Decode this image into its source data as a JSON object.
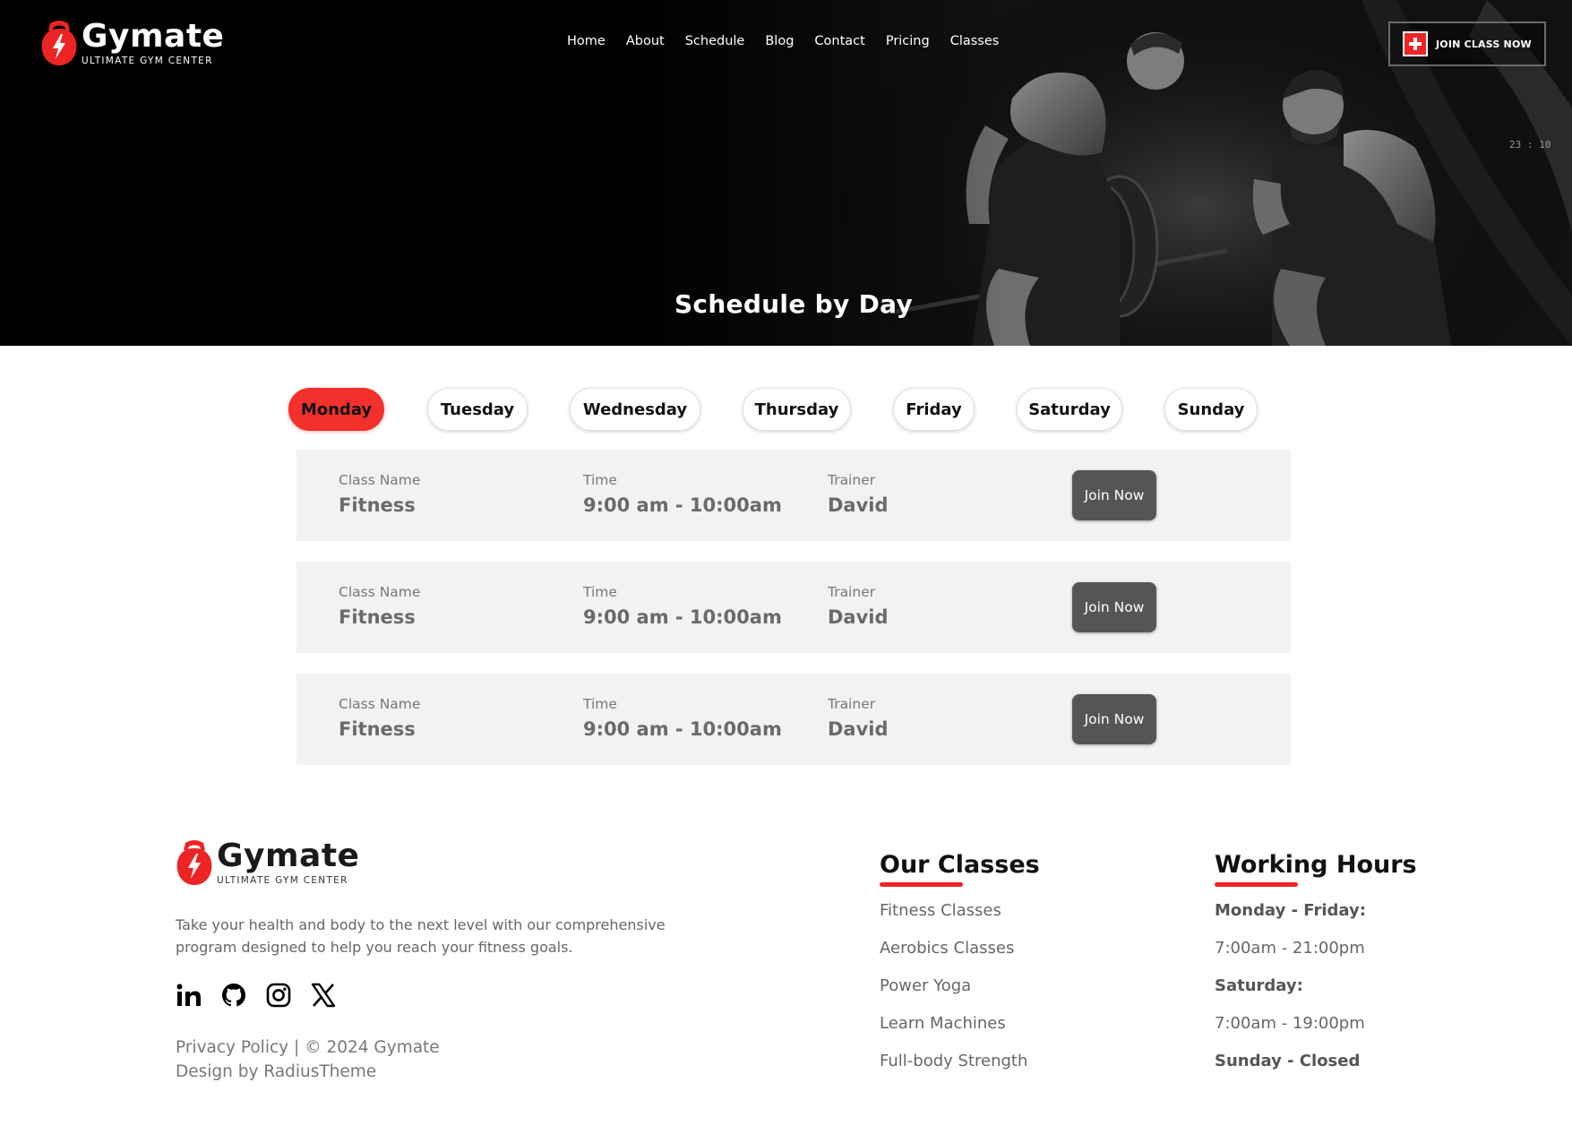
{
  "header": {
    "brand": "Gymate",
    "tagline": "ULTIMATE GYM CENTER",
    "nav": [
      "Home",
      "About",
      "Schedule",
      "Blog",
      "Contact",
      "Pricing",
      "Classes"
    ],
    "cta_label": "JOIN CLASS NOW",
    "hero_title": "Schedule by Day",
    "photo_clock": "23 : 10"
  },
  "days": [
    {
      "label": "Monday",
      "active": true
    },
    {
      "label": "Tuesday",
      "active": false
    },
    {
      "label": "Wednesday",
      "active": false
    },
    {
      "label": "Thursday",
      "active": false
    },
    {
      "label": "Friday",
      "active": false
    },
    {
      "label": "Saturday",
      "active": false
    },
    {
      "label": "Sunday",
      "active": false
    }
  ],
  "schedule": {
    "headers": {
      "class": "Class Name",
      "time": "Time",
      "trainer": "Trainer"
    },
    "join_label": "Join Now",
    "rows": [
      {
        "class": "Fitness",
        "time": "9:00 am - 10:00am",
        "trainer": "David"
      },
      {
        "class": "Fitness",
        "time": "9:00 am - 10:00am",
        "trainer": "David"
      },
      {
        "class": "Fitness",
        "time": "9:00 am - 10:00am",
        "trainer": "David"
      }
    ]
  },
  "footer": {
    "brand": "Gymate",
    "tagline": "ULTIMATE GYM CENTER",
    "description": "Take your health and body to the next level with our comprehensive program designed to help you reach your fitness goals.",
    "socials": [
      "linkedin-icon",
      "github-icon",
      "instagram-icon",
      "x-icon"
    ],
    "privacy": "Privacy Policy",
    "copyright": " | © 2024 Gymate",
    "design_by": "Design by RadiusTheme",
    "classes_title": "Our Classes",
    "classes": [
      "Fitness Classes",
      "Aerobics Classes",
      "Power Yoga",
      "Learn Machines",
      "Full-body Strength"
    ],
    "hours_title": "Working Hours",
    "hours": {
      "weekday_label": "Monday - Friday:",
      "weekday_hours": "7:00am - 21:00pm",
      "saturday_label": "Saturday:",
      "saturday_hours": "7:00am - 19:00pm",
      "sunday": "Sunday - Closed"
    }
  },
  "colors": {
    "accent": "#ec2424",
    "button": "#555555",
    "row_bg": "#f2f2f2"
  }
}
